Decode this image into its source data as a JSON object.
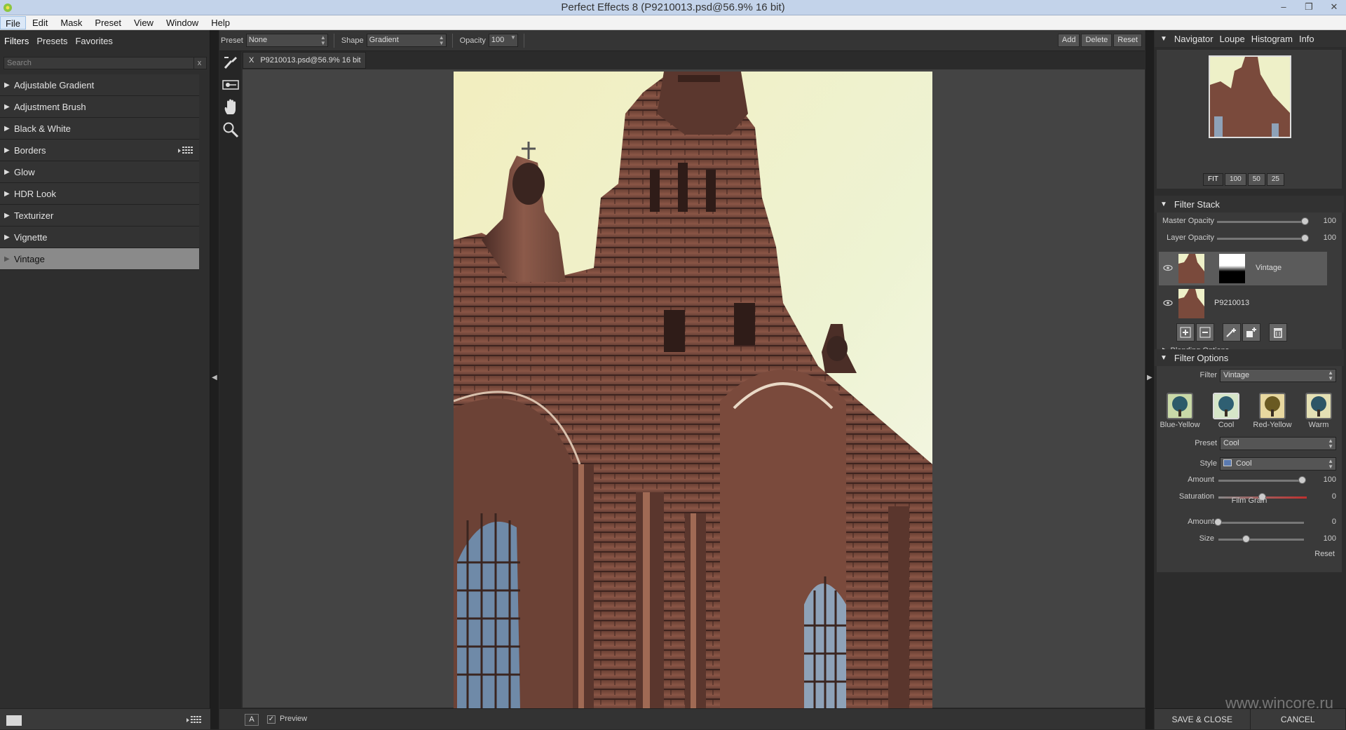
{
  "window": {
    "title": "Perfect Effects 8 (P9210013.psd@56.9% 16 bit)"
  },
  "menu": [
    "File",
    "Edit",
    "Mask",
    "Preset",
    "View",
    "Window",
    "Help"
  ],
  "left": {
    "tabs": [
      "Filters",
      "Presets",
      "Favorites"
    ],
    "search_placeholder": "Search",
    "search_clear": "x",
    "filters": [
      "Adjustable Gradient",
      "Adjustment Brush",
      "Black & White",
      "Borders",
      "Glow",
      "HDR Look",
      "Texturizer",
      "Vignette",
      "Vintage"
    ],
    "selected_filter": "Vintage"
  },
  "toolbar": {
    "preset_label": "Preset",
    "preset_value": "None",
    "shape_label": "Shape",
    "shape_value": "Gradient",
    "opacity_label": "Opacity",
    "opacity_value": "100",
    "add": "Add",
    "delete": "Delete",
    "reset": "Reset"
  },
  "document": {
    "tab_close": "X",
    "tab_label": "P9210013.psd@56.9% 16 bit"
  },
  "bottom": {
    "mode": "A",
    "preview_check": "✓",
    "preview": "Preview"
  },
  "navigator": {
    "tabs": [
      "Navigator",
      "Loupe",
      "Histogram",
      "Info"
    ],
    "zoom": [
      "FIT",
      "100",
      "50",
      "25"
    ]
  },
  "filter_stack": {
    "title": "Filter Stack",
    "master_opacity_label": "Master Opacity",
    "master_opacity": "100",
    "master_opacity_level": 1.0,
    "layer_opacity_label": "Layer Opacity",
    "layer_opacity": "100",
    "layer_opacity_level": 1.0,
    "layers": [
      "Vintage",
      "P9210013"
    ],
    "blending": "Blending Options"
  },
  "filter_options": {
    "title": "Filter Options",
    "filter_label": "Filter",
    "filter_value": "Vintage",
    "presets": [
      "Blue-Yellow",
      "Cool",
      "Red-Yellow",
      "Warm"
    ],
    "selected_preset": "Cool",
    "preset_label": "Preset",
    "preset_value": "Cool",
    "style_label": "Style",
    "style_value": "Cool",
    "amount_label": "Amount",
    "amount": "100",
    "amount_level": 1.0,
    "saturation_label": "Saturation",
    "saturation": "0",
    "saturation_level": 0.5,
    "film_grain": "Film Grain",
    "grain_amount_label": "Amount",
    "grain_amount": "0",
    "grain_amount_level": 0.0,
    "grain_size_label": "Size",
    "grain_size": "100",
    "grain_size_level": 0.33,
    "reset": "Reset"
  },
  "actions": {
    "save": "SAVE & CLOSE",
    "cancel": "CANCEL"
  },
  "watermark": "www.wincore.ru",
  "colors": {
    "accent_red": "#c0302e",
    "selected_filter_bg": "#8a8a8a"
  }
}
